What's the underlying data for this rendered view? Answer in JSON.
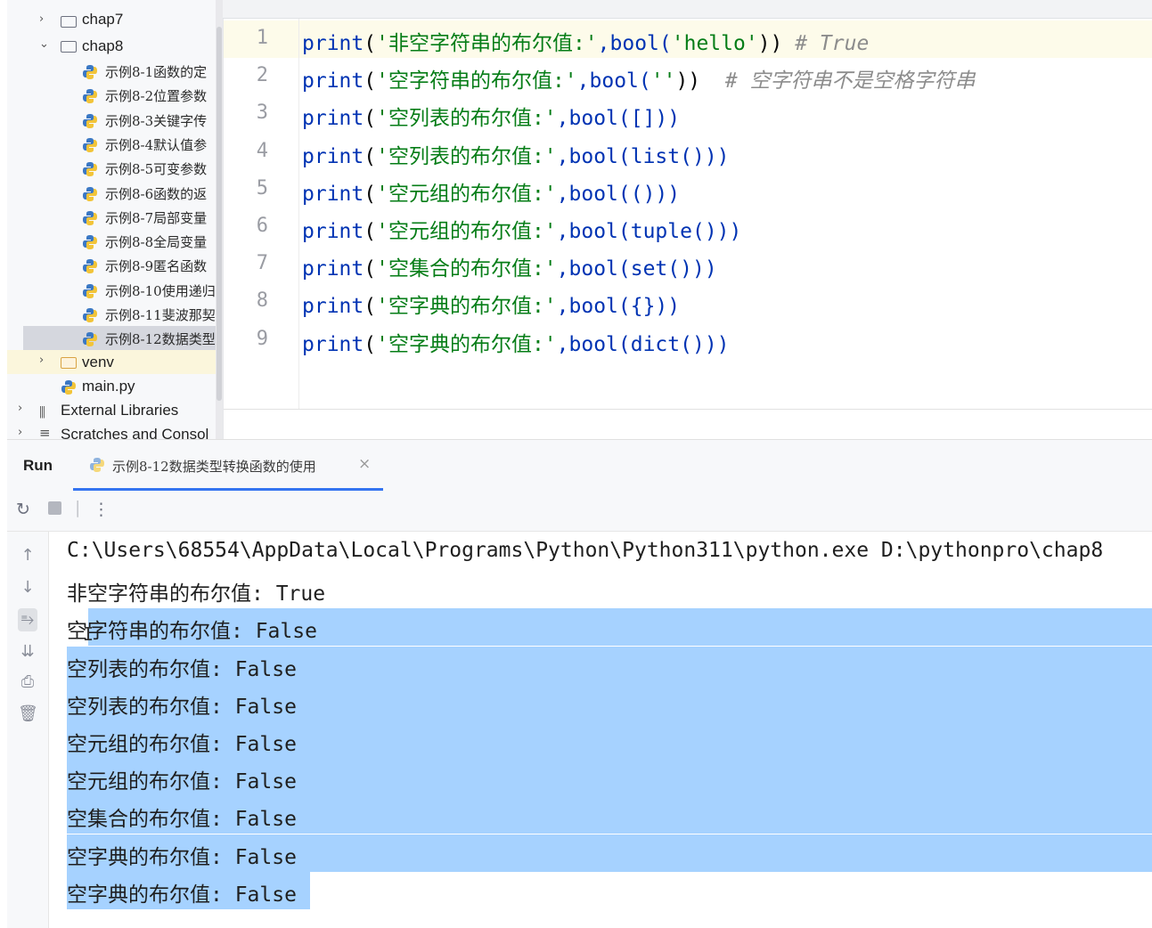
{
  "project_tree": {
    "items": [
      {
        "label": "chap7",
        "type": "folder",
        "expanded": false
      },
      {
        "label": "chap8",
        "type": "folder",
        "expanded": true
      },
      {
        "label": "示例8-1函数的定",
        "type": "file"
      },
      {
        "label": "示例8-2位置参数",
        "type": "file"
      },
      {
        "label": "示例8-3关键字传",
        "type": "file"
      },
      {
        "label": "示例8-4默认值参",
        "type": "file"
      },
      {
        "label": "示例8-5可变参数",
        "type": "file"
      },
      {
        "label": "示例8-6函数的返",
        "type": "file"
      },
      {
        "label": "示例8-7局部变量",
        "type": "file"
      },
      {
        "label": "示例8-8全局变量",
        "type": "file"
      },
      {
        "label": "示例8-9匿名函数",
        "type": "file"
      },
      {
        "label": "示例8-10使用递归",
        "type": "file"
      },
      {
        "label": "示例8-11斐波那契",
        "type": "file"
      },
      {
        "label": "示例8-12数据类型",
        "type": "file",
        "selected": true
      },
      {
        "label": "venv",
        "type": "folder",
        "expanded": false
      },
      {
        "label": "main.py",
        "type": "file"
      },
      {
        "label": "External Libraries",
        "type": "library"
      },
      {
        "label": "Scratches and Consol",
        "type": "scratch"
      }
    ]
  },
  "editor": {
    "lines": [
      {
        "n": "1",
        "fn": "print",
        "open": "(",
        "str": "'非空字符串的布尔值:'",
        "rest": ",bool(",
        "arg": "'hello'",
        "close": "))",
        "comment": " # True"
      },
      {
        "n": "2",
        "fn": "print",
        "open": "(",
        "str": "'空字符串的布尔值:'",
        "rest": ",bool(",
        "arg": "''",
        "close": "))",
        "comment": "  # 空字符串不是空格字符串"
      },
      {
        "n": "3",
        "fn": "print",
        "open": "(",
        "str": "'空列表的布尔值:'",
        "rest": ",bool([]))",
        "arg": "",
        "close": "",
        "comment": ""
      },
      {
        "n": "4",
        "fn": "print",
        "open": "(",
        "str": "'空列表的布尔值:'",
        "rest": ",bool(list()))",
        "arg": "",
        "close": "",
        "comment": ""
      },
      {
        "n": "5",
        "fn": "print",
        "open": "(",
        "str": "'空元组的布尔值:'",
        "rest": ",bool(()))",
        "arg": "",
        "close": "",
        "comment": ""
      },
      {
        "n": "6",
        "fn": "print",
        "open": "(",
        "str": "'空元组的布尔值:'",
        "rest": ",bool(tuple()))",
        "arg": "",
        "close": "",
        "comment": ""
      },
      {
        "n": "7",
        "fn": "print",
        "open": "(",
        "str": "'空集合的布尔值:'",
        "rest": ",bool(set()))",
        "arg": "",
        "close": "",
        "comment": ""
      },
      {
        "n": "8",
        "fn": "print",
        "open": "(",
        "str": "'空字典的布尔值:'",
        "rest": ",bool({}))",
        "arg": "",
        "close": "",
        "comment": ""
      },
      {
        "n": "9",
        "fn": "print",
        "open": "(",
        "str": "'空字典的布尔值:'",
        "rest": ",bool(dict()))",
        "arg": "",
        "close": "",
        "comment": ""
      }
    ]
  },
  "run": {
    "label": "Run",
    "tab_title": "示例8-12数据类型转换函数的使用",
    "tab_close": "×",
    "console": [
      "C:\\Users\\68554\\AppData\\Local\\Programs\\Python\\Python311\\python.exe D:\\pythonpro\\chap8",
      "非空字符串的布尔值: True",
      "空字符串的布尔值: False",
      "空列表的布尔值: False",
      "空列表的布尔值: False",
      "空元组的布尔值: False",
      "空元组的布尔值: False",
      "空集合的布尔值: False",
      "空字典的布尔值: False",
      "空字典的布尔值: False"
    ]
  },
  "colors": {
    "keyword": "#0033b3",
    "string": "#067d17",
    "comment": "#8c8c8c",
    "selection": "#a6d2ff",
    "tab_underline": "#3574f0"
  },
  "icons": {
    "toolbar": [
      "rerun-icon",
      "stop-icon",
      "more-icon"
    ],
    "side": [
      "arrow-up-icon",
      "arrow-down-icon",
      "soft-wrap-icon",
      "scroll-to-end-icon",
      "print-icon",
      "trash-icon"
    ]
  }
}
